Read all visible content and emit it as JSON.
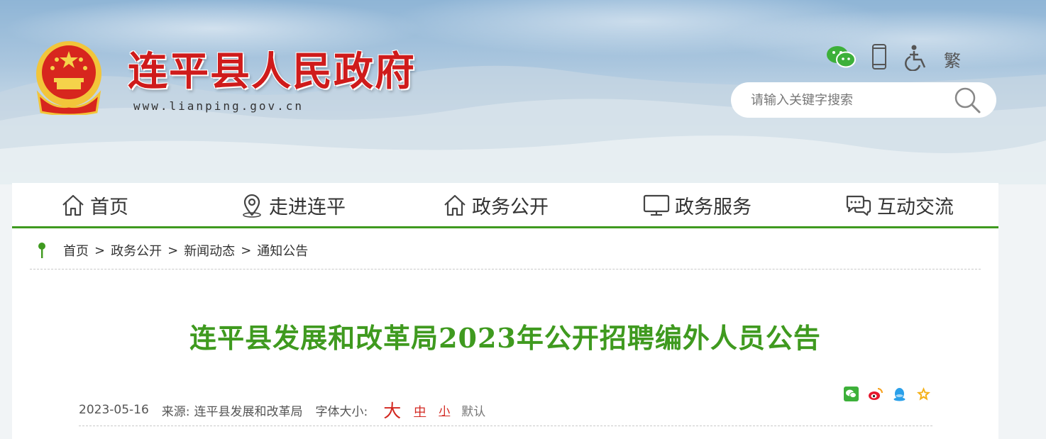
{
  "header": {
    "site_title": "连平县人民政府",
    "site_url": "www.lianping.gov.cn",
    "tools": {
      "wechat_icon": "wechat-icon",
      "mobile_icon": "mobile-phone-icon",
      "accessibility_icon": "accessibility-icon",
      "traditional_label": "繁"
    },
    "search": {
      "placeholder": "请输入关键字搜索",
      "icon": "search-icon"
    }
  },
  "nav": {
    "items": [
      {
        "label": "首页",
        "icon": "home-icon"
      },
      {
        "label": "走进连平",
        "icon": "location-pin-icon"
      },
      {
        "label": "政务公开",
        "icon": "home-icon"
      },
      {
        "label": "政务服务",
        "icon": "monitor-icon"
      },
      {
        "label": "互动交流",
        "icon": "chat-bubbles-icon"
      }
    ],
    "accent_color": "#3f9a1f"
  },
  "breadcrumb": {
    "icon": "map-pin-icon",
    "items": [
      "首页",
      "政务公开",
      "新闻动态",
      "通知公告"
    ],
    "separator": ">"
  },
  "article": {
    "title": "连平县发展和改革局2023年公开招聘编外人员公告",
    "date": "2023-05-16",
    "source_label": "来源:",
    "source": "连平县发展和改革局",
    "font_size_label": "字体大小:",
    "font_sizes": {
      "large": "大",
      "medium": "中",
      "small": "小",
      "default": "默认"
    },
    "share_icons": [
      "wechat-share-icon",
      "weibo-share-icon",
      "qq-share-icon",
      "favorite-star-icon"
    ],
    "title_color": "#3f9a1f",
    "font_size_color": "#d2261f"
  }
}
